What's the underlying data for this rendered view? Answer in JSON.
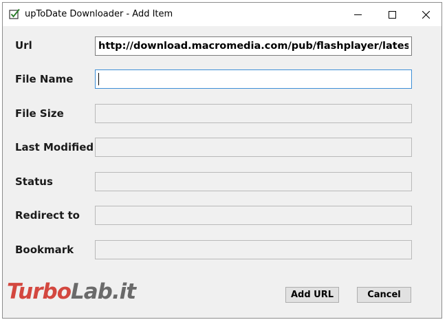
{
  "window": {
    "title": "upToDate Downloader - Add Item",
    "controls": {
      "minimize": "minimize-icon",
      "maximize": "maximize-icon",
      "close": "close-icon"
    }
  },
  "form": {
    "url": {
      "label": "Url",
      "value": "http://download.macromedia.com/pub/flashplayer/latest/h"
    },
    "file_name": {
      "label": "File Name",
      "value": ""
    },
    "file_size": {
      "label": "File Size",
      "value": ""
    },
    "last_modified": {
      "label": "Last Modified",
      "value": ""
    },
    "status": {
      "label": "Status",
      "value": ""
    },
    "redirect_to": {
      "label": "Redirect to",
      "value": ""
    },
    "bookmark": {
      "label": "Bookmark",
      "value": ""
    }
  },
  "buttons": {
    "add_url": "Add URL",
    "cancel": "Cancel"
  },
  "watermark": {
    "part1": "Turbo",
    "part2": "Lab.it"
  },
  "colors": {
    "focus_border": "#3c8ed6",
    "watermark_red": "#d0352c",
    "watermark_gray": "#5c5c5c"
  }
}
